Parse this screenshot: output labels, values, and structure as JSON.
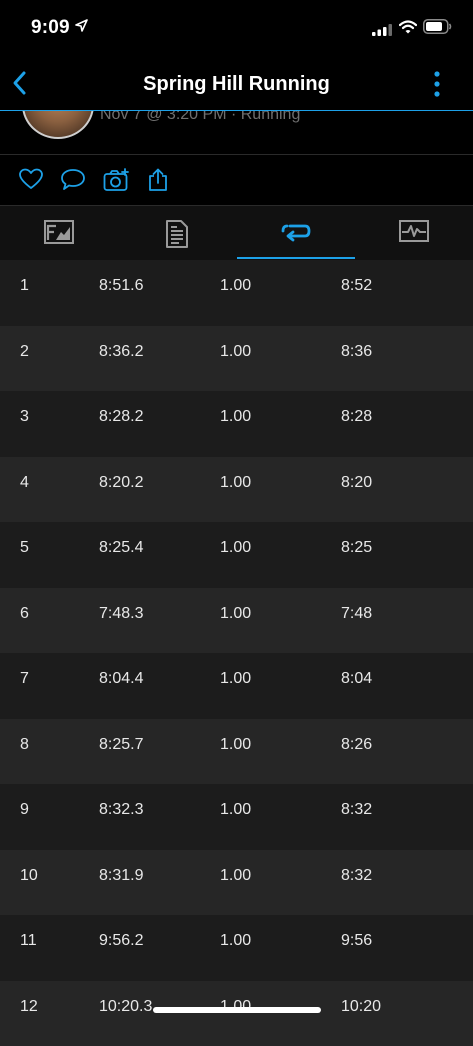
{
  "status_bar": {
    "time": "9:09"
  },
  "nav": {
    "title": "Spring Hill Running"
  },
  "activity": {
    "meta": "Nov 7 @ 3:20 PM · Running"
  },
  "laps": [
    {
      "lap": "1",
      "time": "8:51.6",
      "distance": "1.00",
      "pace": "8:52"
    },
    {
      "lap": "2",
      "time": "8:36.2",
      "distance": "1.00",
      "pace": "8:36"
    },
    {
      "lap": "3",
      "time": "8:28.2",
      "distance": "1.00",
      "pace": "8:28"
    },
    {
      "lap": "4",
      "time": "8:20.2",
      "distance": "1.00",
      "pace": "8:20"
    },
    {
      "lap": "5",
      "time": "8:25.4",
      "distance": "1.00",
      "pace": "8:25"
    },
    {
      "lap": "6",
      "time": "7:48.3",
      "distance": "1.00",
      "pace": "7:48"
    },
    {
      "lap": "7",
      "time": "8:04.4",
      "distance": "1.00",
      "pace": "8:04"
    },
    {
      "lap": "8",
      "time": "8:25.7",
      "distance": "1.00",
      "pace": "8:26"
    },
    {
      "lap": "9",
      "time": "8:32.3",
      "distance": "1.00",
      "pace": "8:32"
    },
    {
      "lap": "10",
      "time": "8:31.9",
      "distance": "1.00",
      "pace": "8:32"
    },
    {
      "lap": "11",
      "time": "9:56.2",
      "distance": "1.00",
      "pace": "9:56"
    },
    {
      "lap": "12",
      "time": "10:20.3",
      "distance": "1.00",
      "pace": "10:20"
    }
  ],
  "icons": {
    "back": "chevron-left-icon",
    "more": "more-vertical-icon",
    "like": "heart-icon",
    "comment": "comment-icon",
    "photo": "camera-add-icon",
    "share": "share-icon",
    "tabs": [
      "overview-tab-icon",
      "details-tab-icon",
      "laps-tab-icon",
      "chart-tab-icon"
    ]
  },
  "colors": {
    "accent": "#1da1e8",
    "background": "#000000",
    "row_odd": "#1c1c1c",
    "row_even": "#262626"
  }
}
